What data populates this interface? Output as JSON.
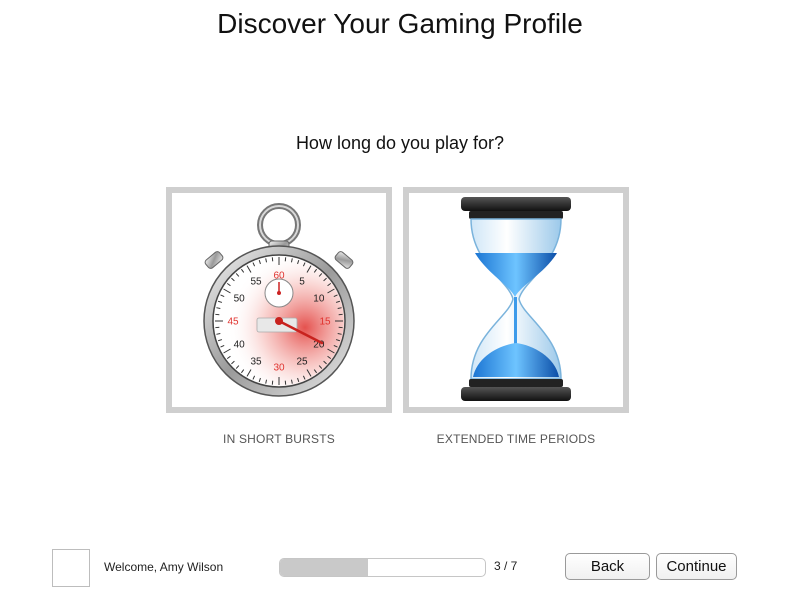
{
  "header": {
    "title": "Discover Your Gaming Profile"
  },
  "question": {
    "text": "How long do you play for?"
  },
  "options": [
    {
      "label": "IN SHORT BURSTS",
      "icon": "stopwatch-icon"
    },
    {
      "label": "EXTENDED TIME PERIODS",
      "icon": "hourglass-icon"
    }
  ],
  "stopwatch": {
    "dial_numbers": [
      "60",
      "5",
      "10",
      "15",
      "20",
      "25",
      "30",
      "35",
      "40",
      "45",
      "50",
      "55"
    ],
    "accent_color": "#e0332f"
  },
  "footer": {
    "welcome": "Welcome, Amy Wilson",
    "progress": {
      "text": "3 / 7",
      "fraction": 0.43
    },
    "back_label": "Back",
    "continue_label": "Continue"
  }
}
